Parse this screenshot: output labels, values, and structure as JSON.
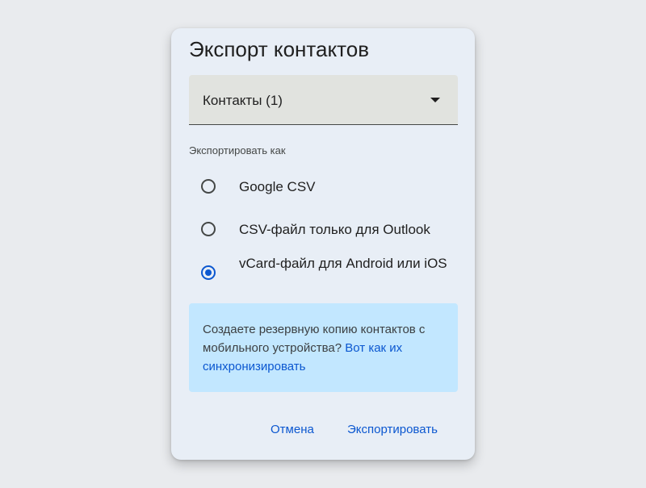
{
  "dialog": {
    "title": "Экспорт контактов",
    "select": {
      "value": "Контакты (1)",
      "icon": "arrow-drop-down-icon"
    },
    "section_label": "Экспортировать как",
    "options": [
      {
        "label": "Google CSV",
        "checked": false
      },
      {
        "label": "CSV-файл только для Outlook",
        "checked": false
      },
      {
        "label": "vCard-файл для Android или iOS",
        "checked": true
      }
    ],
    "info": {
      "text": "Создаете резервную копию контактов с мобильного устройства? ",
      "link": "Вот как их синхронизировать"
    },
    "buttons": {
      "cancel": "Отмена",
      "export": "Экспортировать"
    }
  },
  "colors": {
    "accent": "#0b57d0",
    "dialog_bg": "#e8eef6",
    "info_bg": "#c2e7ff",
    "select_bg": "#e1e3df"
  }
}
